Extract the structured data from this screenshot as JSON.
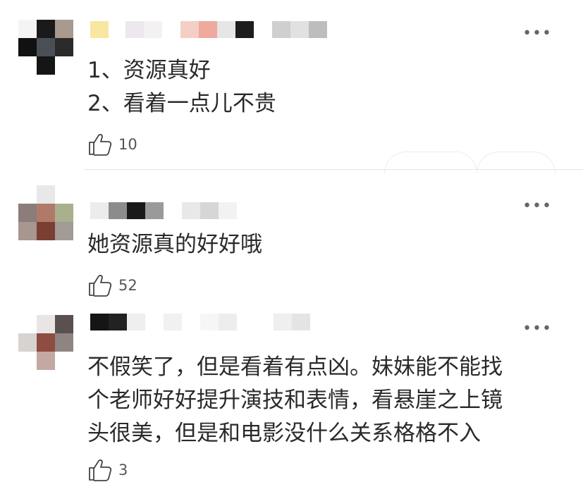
{
  "comments": [
    {
      "lines": [
        "1、资源真好",
        "2、看着一点儿不贵"
      ],
      "likes": "10",
      "more_icon": "more-horizontal-icon",
      "like_icon": "thumbs-up-icon"
    },
    {
      "lines": [
        "她资源真的好好哦"
      ],
      "likes": "52",
      "more_icon": "more-horizontal-icon",
      "like_icon": "thumbs-up-icon"
    },
    {
      "lines": [
        "不假笑了，但是看着有点凶。妹妹能不能找",
        "个老师好好提升演技和表情，看悬崖之上镜",
        "头很美，但是和电影没什么关系格格不入"
      ],
      "likes": "3",
      "more_icon": "more-horizontal-icon",
      "like_icon": "thumbs-up-icon"
    }
  ],
  "more_glyph": "•••"
}
